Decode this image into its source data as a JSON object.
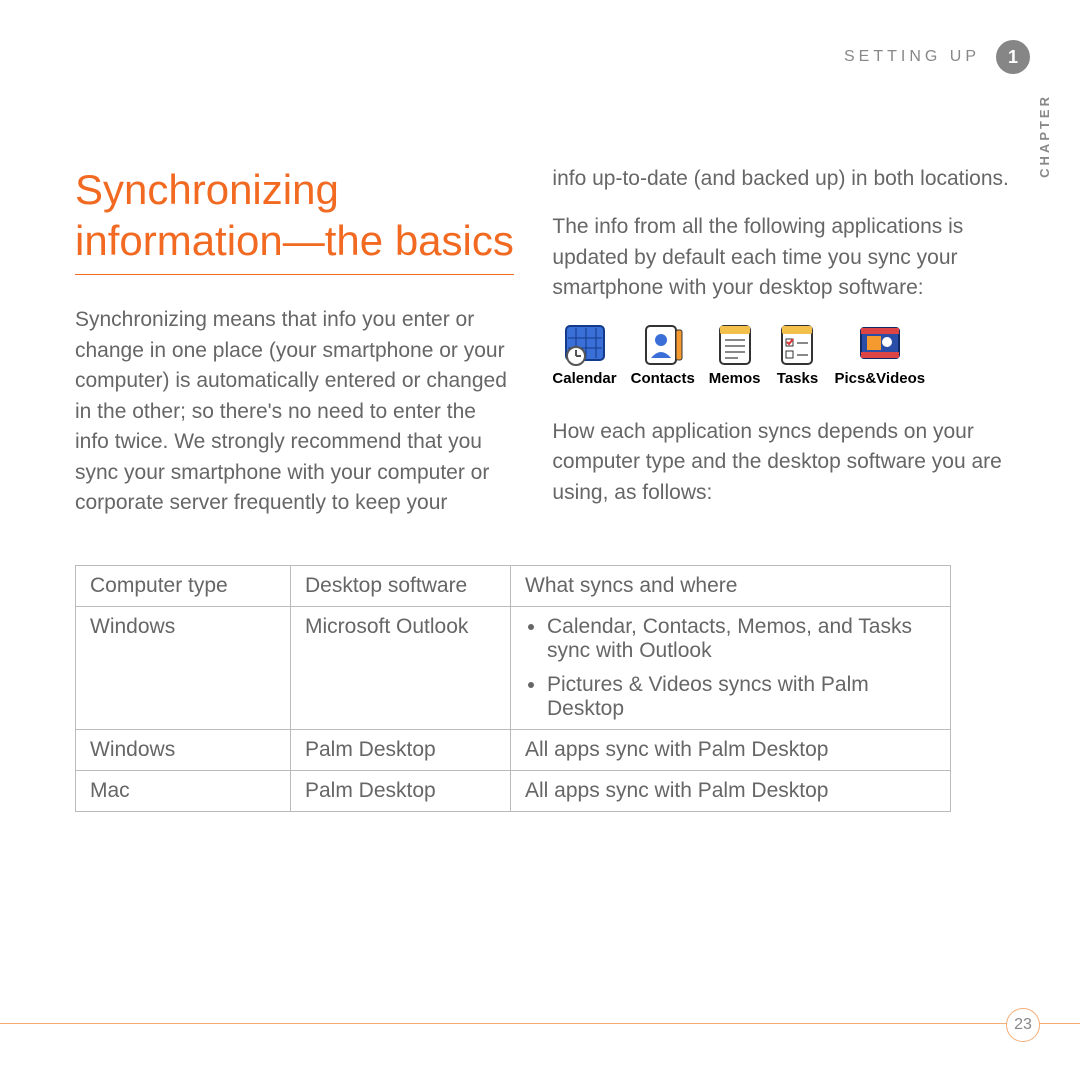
{
  "header": {
    "section_label": "SETTING UP",
    "chapter_number": "1",
    "chapter_word": "CHAPTER"
  },
  "title": "Synchronizing information—the basics",
  "left_para": "Synchronizing means that info you enter or change in one place (your smartphone or your computer) is automatically entered or changed in the other; so there's no need to enter the info twice. We strongly recommend that you sync your smartphone with your computer or corporate server frequently to keep your",
  "right": {
    "para1": "info up-to-date (and backed up) in both locations.",
    "para2": "The info from all the following applications is updated by default each time you sync your smartphone with your desktop software:",
    "para3": "How each application syncs depends on your computer type and the desktop software you are using, as follows:"
  },
  "apps": {
    "calendar": "Calendar",
    "contacts": "Contacts",
    "memos": "Memos",
    "tasks": "Tasks",
    "pics": "Pics&Videos"
  },
  "table": {
    "headers": {
      "computer_type": "Computer type",
      "desktop_software": "Desktop software",
      "what_syncs": "What syncs and where"
    },
    "rows": [
      {
        "computer": "Windows",
        "software": "Microsoft Outlook",
        "bullets": [
          "Calendar, Contacts, Memos, and Tasks sync with Outlook",
          "Pictures & Videos syncs with Palm Desktop"
        ]
      },
      {
        "computer": "Windows",
        "software": "Palm Desktop",
        "text": "All apps sync with Palm Desktop"
      },
      {
        "computer": "Mac",
        "software": "Palm Desktop",
        "text": "All apps sync with Palm Desktop"
      }
    ]
  },
  "page_number": "23"
}
